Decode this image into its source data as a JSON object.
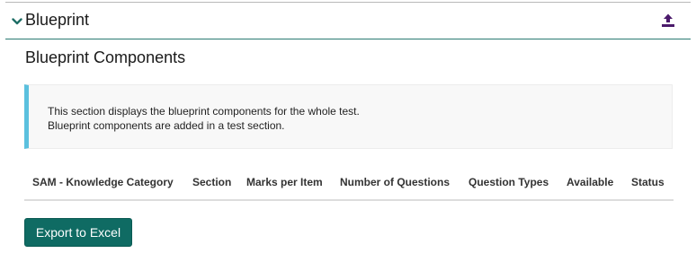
{
  "panel": {
    "title": "Blueprint",
    "chevron_icon": "chevron-down-icon",
    "upload_icon": "upload-icon",
    "accent_color": "#2a7a72",
    "upload_icon_color": "#4b1a6b"
  },
  "section": {
    "title": "Blueprint Components"
  },
  "info": {
    "line1": "This section displays the blueprint components for the whole test.",
    "line2": "Blueprint components are added in a test section.",
    "border_color": "#5bc0de"
  },
  "table": {
    "columns": [
      "SAM - Knowledge Category",
      "Section",
      "Marks per Item",
      "Number of Questions",
      "Question Types",
      "Available",
      "Status"
    ],
    "rows": []
  },
  "actions": {
    "export_label": "Export to Excel",
    "export_color": "#0f6b63"
  }
}
